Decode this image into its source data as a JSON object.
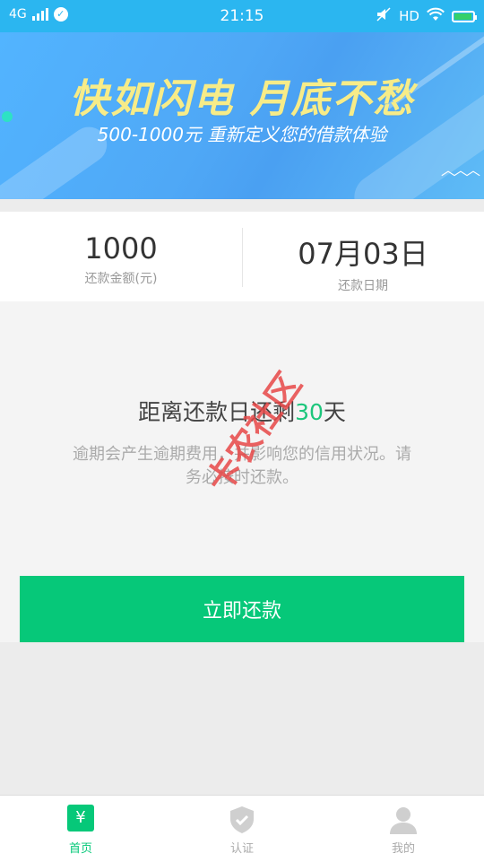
{
  "status_bar": {
    "network": "4G",
    "time": "21:15",
    "hd": "HD"
  },
  "banner": {
    "title": "快如闪电 月底不愁",
    "subtitle": "500-1000元 重新定义您的借款体验"
  },
  "summary": {
    "amount_value": "1000",
    "amount_label": "还款金额(元)",
    "date_value": "07月03日",
    "date_label": "还款日期"
  },
  "countdown": {
    "prefix": "距离还款日还剩",
    "days": "30",
    "suffix": "天"
  },
  "notice": "逾期会产生逾期费用，并影响您的信用状况。请务必按时还款。",
  "repay_button": "立即还款",
  "watermark": "卡农社区",
  "tabbar": {
    "items": [
      {
        "label": "首页",
        "icon": "yen-icon",
        "active": true
      },
      {
        "label": "认证",
        "icon": "shield-check-icon",
        "active": false
      },
      {
        "label": "我的",
        "icon": "user-icon",
        "active": false
      }
    ]
  },
  "colors": {
    "accent": "#06c879",
    "banner": "#4fa8f6",
    "banner_title": "#f7ec88"
  }
}
